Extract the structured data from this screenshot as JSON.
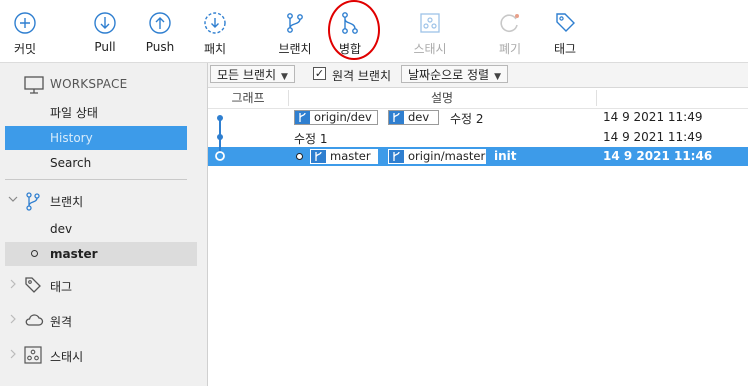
{
  "toolbar": {
    "commit": "커밋",
    "pull": "Pull",
    "push": "Push",
    "fetch": "패치",
    "branch": "브랜치",
    "merge": "병합",
    "stash": "스태시",
    "discard": "폐기",
    "tag": "태그"
  },
  "sidebar": {
    "workspace": "WORKSPACE",
    "items": [
      {
        "label": "파일 상태"
      },
      {
        "label": "History"
      },
      {
        "label": "Search"
      }
    ],
    "branches_label": "브랜치",
    "branches": [
      {
        "label": "dev"
      },
      {
        "label": "master"
      }
    ],
    "tags_label": "태그",
    "remotes_label": "원격",
    "stash_label": "스태시"
  },
  "filters": {
    "all_branches": "모든 브랜치",
    "remote_branches": "원격 브랜치",
    "sort": "날짜순으로 정렬",
    "remote_checked": true
  },
  "table": {
    "col_graph": "그래프",
    "col_desc": "설명",
    "rows": [
      {
        "tags": [
          "origin/dev",
          "dev"
        ],
        "message": "수정 2",
        "date": "14 9 2021 11:49"
      },
      {
        "tags": [],
        "message": "수정 1",
        "date": "14 9 2021 11:49"
      },
      {
        "tags": [
          "master",
          "origin/master"
        ],
        "message": "init",
        "date": "14 9 2021 11:46"
      }
    ]
  },
  "colors": {
    "accent": "#3d9be9",
    "branch_badge": "#2f7fd0",
    "annotation": "#e00000"
  }
}
